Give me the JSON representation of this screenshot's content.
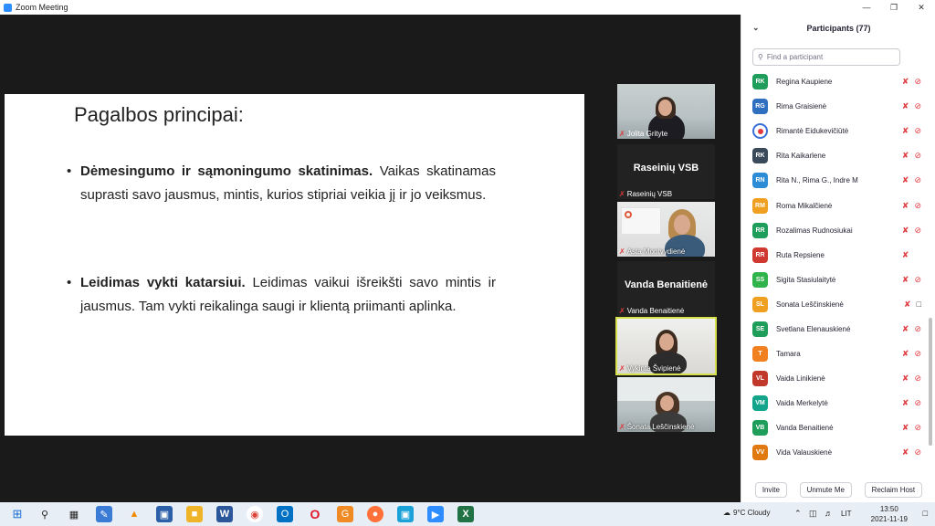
{
  "window": {
    "title": "Zoom Meeting"
  },
  "slide": {
    "title": "Pagalbos principai:",
    "bullets": [
      {
        "bold": "Dėmesingumo ir sąmoningumo skatinimas.",
        "text": " Vaikas skatinamas suprasti savo jausmus, mintis, kurios stipriai veikia jį ir jo veiksmus."
      },
      {
        "bold": "Leidimas vykti katarsiui.",
        "text": " Leidimas vaikui išreikšti savo mintis ir jausmus. Tam vykti reikalinga saugi ir klientą priimanti aplinka."
      }
    ]
  },
  "tiles": [
    {
      "name": "Jolita Grityte",
      "kind": "video"
    },
    {
      "name": "Raseinių VSB",
      "label": "Raseinių VSB",
      "kind": "name"
    },
    {
      "name": "Asta Montvydienė",
      "kind": "video"
    },
    {
      "name": "Vanda Benaitienė",
      "label": "Vanda Benaitienė",
      "kind": "name"
    },
    {
      "name": "Vykinta Švipienė",
      "kind": "video",
      "active": true
    },
    {
      "name": "Šonata Leščinskienė",
      "kind": "video"
    }
  ],
  "participants_panel": {
    "title": "Participants (77)",
    "search_placeholder": "Find a participant",
    "items": [
      {
        "initials": "RK",
        "name": "Regina Kaupiene",
        "color": "#1e9e5a",
        "video": "off"
      },
      {
        "initials": "RG",
        "name": "Rima Graisienė",
        "color": "#2f6fbf",
        "video": "off"
      },
      {
        "initials": "",
        "name": "Rimantė Eidukevičiūtė",
        "color": "#ffffff",
        "video": "off",
        "logo": true
      },
      {
        "initials": "RK",
        "name": "Rita Kaikarlene",
        "color": "#3a4a5a",
        "video": "off"
      },
      {
        "initials": "RN",
        "name": "Rita N., Rima G., Indre M",
        "color": "#2d8cd6",
        "video": "off"
      },
      {
        "initials": "RM",
        "name": "Roma Mikalčienė",
        "color": "#f0a020",
        "video": "off"
      },
      {
        "initials": "RR",
        "name": "Rozalimas Rudnosiukai",
        "color": "#1e9e5a",
        "video": "off"
      },
      {
        "initials": "RR",
        "name": "Ruta Repsiene",
        "color": "#d0392f",
        "video": "none"
      },
      {
        "initials": "SS",
        "name": "Sigita Stasiulaitytė",
        "color": "#2fb34a",
        "video": "off"
      },
      {
        "initials": "SL",
        "name": "Sonata Leščinskienė",
        "color": "#f0a020",
        "video": "on"
      },
      {
        "initials": "SE",
        "name": "Svetlana Elenauskienė",
        "color": "#1e9e5a",
        "video": "off"
      },
      {
        "initials": "T",
        "name": "Tamara",
        "color": "#f08020",
        "video": "off"
      },
      {
        "initials": "VL",
        "name": "Vaida Linikienė",
        "color": "#c0392b",
        "video": "off"
      },
      {
        "initials": "VM",
        "name": "Vaida Merkelytė",
        "color": "#12a58c",
        "video": "off"
      },
      {
        "initials": "VB",
        "name": "Vanda Benaitienė",
        "color": "#1e9e5a",
        "video": "off"
      },
      {
        "initials": "VV",
        "name": "Vida Valauskienė",
        "color": "#e07a10",
        "video": "off"
      }
    ],
    "footer": {
      "invite": "Invite",
      "unmute": "Unmute Me",
      "reclaim": "Reclaim Host"
    }
  },
  "taskbar": {
    "weather": "9°C  Cloudy",
    "lang": "LIT",
    "time": "13:50",
    "date": "2021-11-19"
  }
}
